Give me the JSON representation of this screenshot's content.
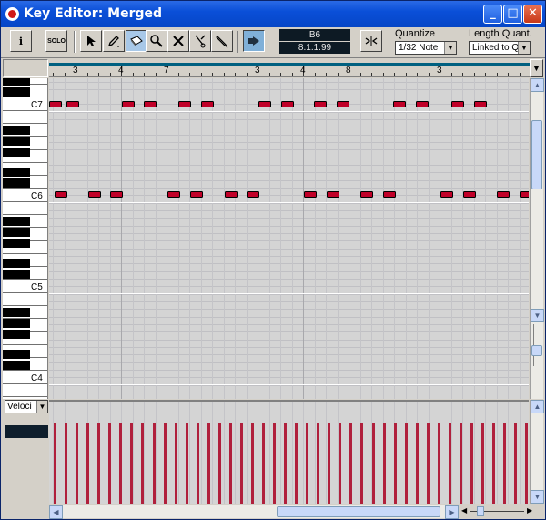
{
  "window": {
    "title": "Key Editor: Merged"
  },
  "toolbar": {
    "info_label": "i",
    "solo_label": "SOLO",
    "position_display": {
      "pitch": "B6",
      "position": "8.1.1.99"
    },
    "quantize": {
      "label": "Quantize",
      "value": "1/32 Note"
    },
    "length_quant": {
      "label": "Length Quant.",
      "value": "Linked to Q"
    }
  },
  "ruler": {
    "labels": [
      "3",
      "4",
      "7",
      "3",
      "4",
      "8",
      "3"
    ]
  },
  "keyboard": {
    "labels": [
      "C7",
      "C6",
      "C5",
      "C4"
    ]
  },
  "notes": {
    "row_c7": [
      0,
      19,
      80,
      104,
      142,
      167,
      230,
      255,
      291,
      316,
      378,
      403,
      442,
      467
    ],
    "row_c6": [
      6,
      43,
      67,
      130,
      155,
      193,
      217,
      280,
      305,
      342,
      367,
      430,
      455,
      492,
      517
    ]
  },
  "velocity": {
    "selector_value": "Veloci",
    "bar_count": 44,
    "bar_level": 0.8
  },
  "colors": {
    "note_fill": "#c00028",
    "velocity_bar": "#b0203c",
    "grid_background": "#d4d4d4",
    "title_bar": "#0a4fd8"
  }
}
